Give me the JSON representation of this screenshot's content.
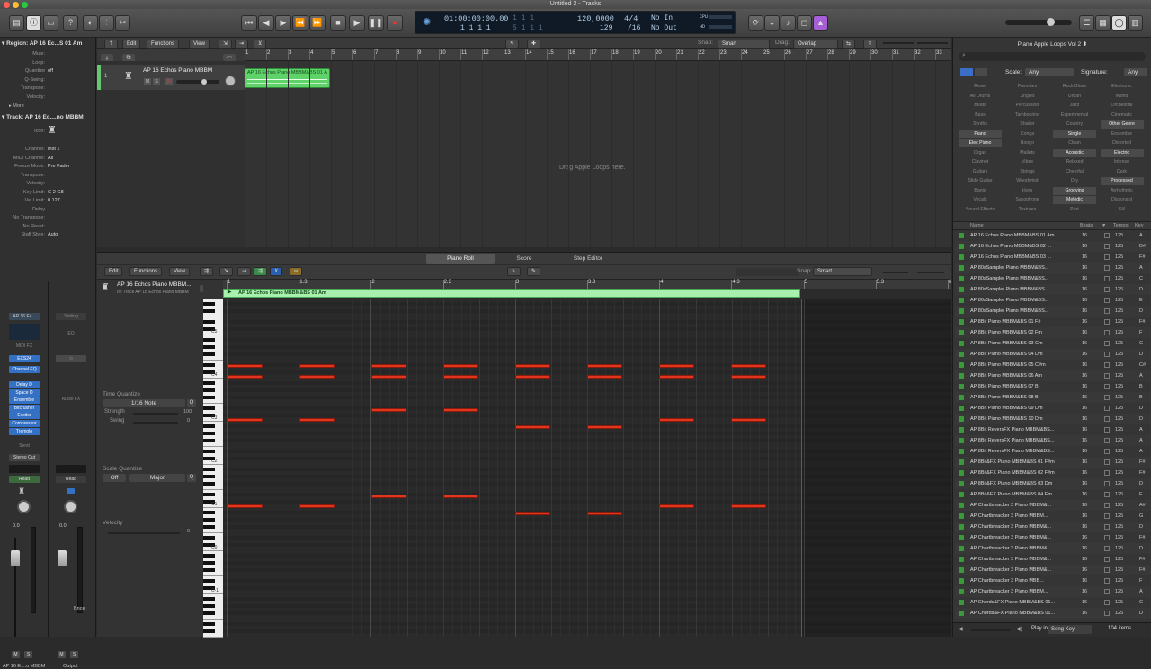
{
  "window": {
    "title": "Untitled 2 - Tracks"
  },
  "toolbar": {
    "lcd": {
      "time": "01:00:00:00.00",
      "time_frames": "1  1  1",
      "position": "1  1  1     1",
      "position2": "5  1  1     1",
      "tempo": "120,0000",
      "tempo2": "129",
      "signature": "4/4",
      "division": "/16",
      "midi_in": "No In",
      "midi_out": "No Out",
      "cpu": "CPU",
      "hd": "HD"
    }
  },
  "inspector": {
    "region_header": "Region: AP 16 Ec...S 01 Am",
    "region_rows": [
      {
        "k": "Mute:",
        "v": ""
      },
      {
        "k": "Loop:",
        "v": ""
      },
      {
        "k": "Quantize",
        "v": "off"
      },
      {
        "k": "Q-Swing:",
        "v": ""
      },
      {
        "k": "Transpose:",
        "v": ""
      },
      {
        "k": "Velocity:",
        "v": ""
      }
    ],
    "more": "More",
    "track_header": "Track:  AP 16 Ec....no MBBM",
    "track_rows": [
      {
        "k": "Icon:",
        "v": ""
      },
      {
        "k": "Channel:",
        "v": "Inst 1"
      },
      {
        "k": "MIDI Channel:",
        "v": "All"
      },
      {
        "k": "Freeze Mode:",
        "v": "Pre Fader"
      },
      {
        "k": "Transpose:",
        "v": ""
      },
      {
        "k": "Velocity:",
        "v": ""
      },
      {
        "k": "Key Limit:",
        "v": "C-2      G8"
      },
      {
        "k": "Vel Limit:",
        "v": "0      127"
      },
      {
        "k": "Delay",
        "v": ""
      },
      {
        "k": "No Transpose:",
        "v": ""
      },
      {
        "k": "No Reset:",
        "v": ""
      },
      {
        "k": "Staff Style:",
        "v": "Auto"
      }
    ],
    "strip1": {
      "name": "AP 16 Ec...",
      "midi_fx": "MIDI FX",
      "instrument": "EXS24",
      "eq": "Channel EQ",
      "fx": [
        "Delay D",
        "Space D",
        "Ensemble",
        "Bitcrusher",
        "Exciter",
        "Compressor",
        "Tremolo"
      ],
      "send": "Send",
      "output": "Stereo Out",
      "read": "Read",
      "pan": "0.0",
      "footer": "AP 16 E....o MBBM"
    },
    "strip2": {
      "setting": "Setting",
      "eq": "EQ",
      "audio_fx": "Audio FX",
      "read": "Read",
      "pan": "0.0",
      "bounce": "Bnce",
      "footer": "Output"
    },
    "ms": [
      "M",
      "S",
      "M",
      "S"
    ]
  },
  "tracks_area": {
    "menu": [
      "Edit",
      "Functions",
      "View"
    ],
    "snap_label": "Snap:",
    "snap_value": "Smart",
    "drag_label": "Drag:",
    "drag_value": "Overlap",
    "track_name": "AP 16 Echos Piano MBBM",
    "track_number": "1",
    "region_name": "AP 16 Echos Piano MBBM&BS 01 A",
    "ruler": [
      "1",
      "2",
      "3",
      "4",
      "5",
      "6",
      "7",
      "8",
      "9",
      "10",
      "11",
      "12",
      "13",
      "14",
      "15",
      "16",
      "17",
      "18",
      "19",
      "20",
      "21",
      "22",
      "23",
      "24",
      "25",
      "26",
      "27",
      "28",
      "29",
      "30",
      "31",
      "32",
      "33"
    ]
  },
  "editor": {
    "tabs": [
      "Piano Roll",
      "Score",
      "Step Editor"
    ],
    "menu": [
      "Edit",
      "Functions",
      "View"
    ],
    "snap_label": "Snap:",
    "snap_value": "Smart",
    "region_title": "AP 16 Echos Piano MBBM...",
    "region_sub": "on Track AP 16 Echos Piano MBBM",
    "region_bar_label": "AP 16 Echos Piano MBBM&BS 01 Am",
    "ruler": [
      "1",
      "1.3",
      "2",
      "2.3",
      "3",
      "3.3",
      "4",
      "4.3",
      "5",
      "5.3",
      "6"
    ],
    "time_quantize": "Time Quantize",
    "tq_value": "1/16 Note",
    "strength_label": "Strength",
    "strength_value": "100",
    "swing_label": "Swing",
    "swing_value": "0",
    "scale_quantize": "Scale Quantize",
    "sq_off": "Off",
    "sq_scale": "Major",
    "velocity_label": "Velocity",
    "velocity_value": "0",
    "octaves": [
      "C5",
      "C4",
      "C3",
      "C2",
      "C1",
      "C0",
      "C-1"
    ]
  },
  "loops": {
    "title": "Piano Apple Loops Vol 2",
    "scale_label": "Scale:",
    "scale_value": "Any",
    "signature_label": "Signature:",
    "signature_value": "Any",
    "keywords": [
      [
        "Reset",
        "Favorites",
        "Rock/Blues",
        "Electronic"
      ],
      [
        "All Drums",
        "Jingles",
        "Urban",
        "World"
      ],
      [
        "Beats",
        "Percussion",
        "Jazz",
        "Orchestral"
      ],
      [
        "Bass",
        "Tambourine",
        "Experimental",
        "Cinematic"
      ],
      [
        "Synths",
        "Shaker",
        "Country",
        "Other Genre"
      ],
      [
        "Piano",
        "Conga",
        "Single",
        "Ensemble"
      ],
      [
        "Elec Piano",
        "Bongo",
        "Clean",
        "Distorted"
      ],
      [
        "Organ",
        "Mallets",
        "Acoustic",
        "Electric"
      ],
      [
        "Clavinet",
        "Vibes",
        "Relaxed",
        "Intense"
      ],
      [
        "Guitars",
        "Strings",
        "Cheerful",
        "Dark"
      ],
      [
        "Slide Guitar",
        "Woodwind",
        "Dry",
        "Processed"
      ],
      [
        "Banjo",
        "Horn",
        "Grooving",
        "Arrhythmic"
      ],
      [
        "Vocals",
        "Saxophone",
        "Melodic",
        "Dissonant"
      ],
      [
        "Sound Effects",
        "Textures",
        "Part",
        "Fill"
      ]
    ],
    "columns": {
      "name": "Name",
      "beats": "Beats",
      "tempo": "Tempo",
      "key": "Key"
    },
    "items": [
      {
        "name": "AP 16 Echos Piano MBBM&BS 01 Am",
        "beats": "16",
        "tempo": "125",
        "key": "A"
      },
      {
        "name": "AP 16 Echos Piano MBBM&BS 02 ...",
        "beats": "16",
        "tempo": "125",
        "key": "D#"
      },
      {
        "name": "AP 16 Echos Piano MBBM&BS 03 ...",
        "beats": "16",
        "tempo": "125",
        "key": "F#"
      },
      {
        "name": "AP 80sSampler Piano MBBM&BS...",
        "beats": "16",
        "tempo": "125",
        "key": "A"
      },
      {
        "name": "AP 80sSampler Piano MBBM&BS...",
        "beats": "16",
        "tempo": "125",
        "key": "C"
      },
      {
        "name": "AP 80sSampler Piano MBBM&BS...",
        "beats": "16",
        "tempo": "125",
        "key": "D"
      },
      {
        "name": "AP 80sSampler Piano MBBM&BS...",
        "beats": "16",
        "tempo": "125",
        "key": "E"
      },
      {
        "name": "AP 80sSampler Piano MBBM&BS...",
        "beats": "16",
        "tempo": "125",
        "key": "D"
      },
      {
        "name": "AP 8Bit Piano MBBM&BS 01 F#",
        "beats": "16",
        "tempo": "125",
        "key": "F#"
      },
      {
        "name": "AP 8Bit Piano MBBM&BS 02 Fm",
        "beats": "16",
        "tempo": "125",
        "key": "F"
      },
      {
        "name": "AP 8Bit Piano MBBM&BS 03 Cm",
        "beats": "16",
        "tempo": "125",
        "key": "C"
      },
      {
        "name": "AP 8Bit Piano MBBM&BS 04 Dm",
        "beats": "16",
        "tempo": "125",
        "key": "D"
      },
      {
        "name": "AP 8Bit Piano MBBM&BS 05 C#m",
        "beats": "16",
        "tempo": "125",
        "key": "C#"
      },
      {
        "name": "AP 8Bit Piano MBBM&BS 06 Am",
        "beats": "16",
        "tempo": "125",
        "key": "A"
      },
      {
        "name": "AP 8Bit Piano MBBM&BS 07 B",
        "beats": "16",
        "tempo": "125",
        "key": "B"
      },
      {
        "name": "AP 8Bit Piano MBBM&BS 08 B",
        "beats": "16",
        "tempo": "125",
        "key": "B"
      },
      {
        "name": "AP 8Bit Piano MBBM&BS 09 Dm",
        "beats": "16",
        "tempo": "125",
        "key": "D"
      },
      {
        "name": "AP 8Bit Piano MBBM&BS 10 Dm",
        "beats": "16",
        "tempo": "125",
        "key": "D"
      },
      {
        "name": "AP 8Bit ReversFX Piano MBBM&BS...",
        "beats": "16",
        "tempo": "125",
        "key": "A"
      },
      {
        "name": "AP 8Bit ReversFX Piano MBBM&BS...",
        "beats": "16",
        "tempo": "125",
        "key": "A"
      },
      {
        "name": "AP 8Bit ReversFX Piano MBBM&BS...",
        "beats": "16",
        "tempo": "125",
        "key": "A"
      },
      {
        "name": "AP 8Bit&FX Piano MBBM&BS 01 F#m",
        "beats": "16",
        "tempo": "125",
        "key": "F#"
      },
      {
        "name": "AP 8Bit&FX Piano MBBM&BS 02 F#m",
        "beats": "16",
        "tempo": "125",
        "key": "F#"
      },
      {
        "name": "AP 8Bit&FX Piano MBBM&BS 03 Dm",
        "beats": "16",
        "tempo": "125",
        "key": "D"
      },
      {
        "name": "AP 8Bit&FX Piano MBBM&BS 04 Em",
        "beats": "16",
        "tempo": "125",
        "key": "E"
      },
      {
        "name": "AP Chartbreacker 3 Piano MBBM&...",
        "beats": "16",
        "tempo": "125",
        "key": "A#"
      },
      {
        "name": "AP Chartbreacker 3 Piano MBBM...",
        "beats": "16",
        "tempo": "125",
        "key": "G"
      },
      {
        "name": "AP Chartbreacker 3 Piano MBBM&...",
        "beats": "16",
        "tempo": "125",
        "key": "D"
      },
      {
        "name": "AP Chartbreacker 3 Piano MBBM&...",
        "beats": "16",
        "tempo": "125",
        "key": "F#"
      },
      {
        "name": "AP Chartbreacker 3 Piano MBBM&...",
        "beats": "16",
        "tempo": "125",
        "key": "D"
      },
      {
        "name": "AP Chartbreacker 3 Piano MBBM&...",
        "beats": "16",
        "tempo": "125",
        "key": "F#"
      },
      {
        "name": "AP Chartbreacker 3 Piano MBBM&...",
        "beats": "16",
        "tempo": "125",
        "key": "F#"
      },
      {
        "name": "AP Chartbreacker 3 Piano MBB...",
        "beats": "16",
        "tempo": "125",
        "key": "F"
      },
      {
        "name": "AP Chartbreacker 3 Piano MBBM...",
        "beats": "16",
        "tempo": "125",
        "key": "A"
      },
      {
        "name": "AP Chords&FX Piano MBBM&BS 01...",
        "beats": "16",
        "tempo": "125",
        "key": "C"
      },
      {
        "name": "AP Chords&FX Piano MBBM&BS 01...",
        "beats": "16",
        "tempo": "125",
        "key": "D"
      }
    ],
    "play_in_label": "Play in:",
    "play_in_value": "Song Key",
    "count": "104 items"
  },
  "colors": {
    "accent": "#3b82d6",
    "region_green": "#5fd36a",
    "note_red": "#e0361f"
  }
}
